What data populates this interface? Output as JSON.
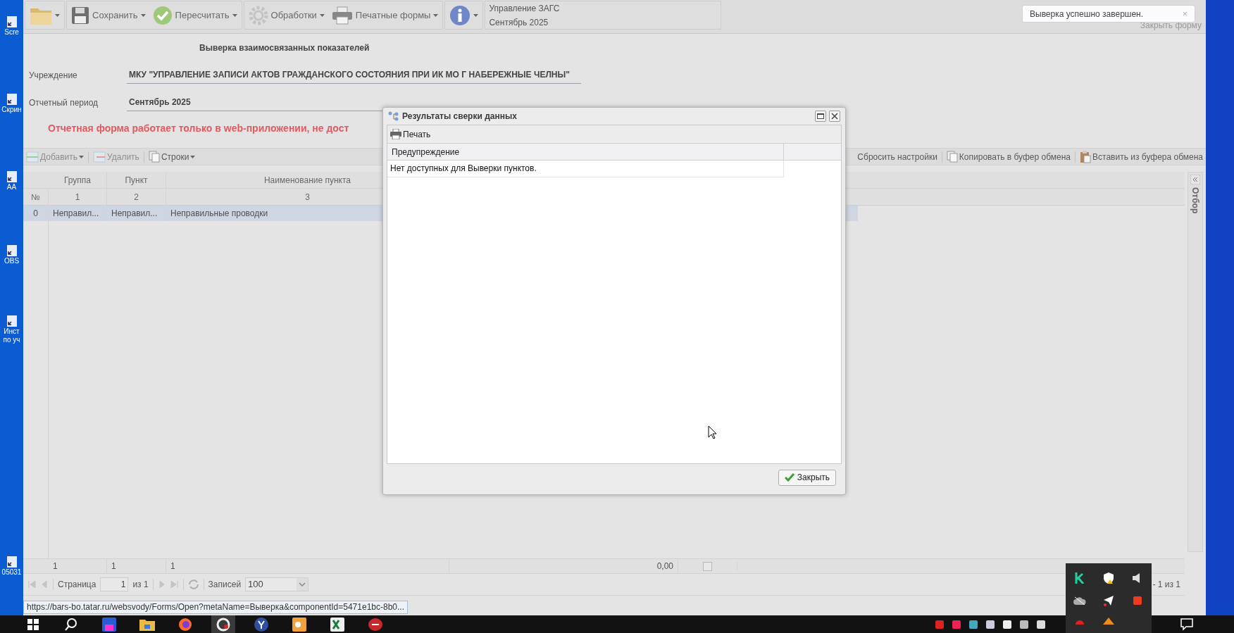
{
  "desktop_icons": [
    {
      "label": "Scre"
    },
    {
      "label": "Скрин"
    },
    {
      "label": "АА"
    },
    {
      "label": "OBS"
    },
    {
      "label": "Инст\nпо уч"
    },
    {
      "label": "05031"
    }
  ],
  "toolbar": {
    "groups": [
      {
        "items": [
          {
            "kind": "folder",
            "dropdown": true
          }
        ]
      },
      {
        "items": [
          {
            "kind": "save",
            "label": "Сохранить",
            "dropdown": true
          },
          {
            "kind": "check",
            "label": "Пересчитать",
            "dropdown": true
          }
        ]
      },
      {
        "items": [
          {
            "kind": "gear",
            "label": "Обработки",
            "dropdown": true
          },
          {
            "kind": "printer",
            "label": "Печатные формы",
            "dropdown": true
          }
        ]
      },
      {
        "items": [
          {
            "kind": "info",
            "dropdown": true
          }
        ]
      }
    ],
    "context": [
      "Управление ЗАГС",
      "Сентябрь 2025"
    ],
    "close_form": "Закрыть форму"
  },
  "notification": {
    "text": "Выверка успешно завершен.",
    "close": "×"
  },
  "form": {
    "title": "Выверка взаимосвязанных показателей",
    "fields": [
      {
        "label": "Учреждение",
        "value": "МКУ \"УПРАВЛЕНИЕ ЗАПИСИ АКТОВ ГРАЖДАНСКОГО СОСТОЯНИЯ ПРИ ИК МО Г НАБЕРЕЖНЫЕ ЧЕЛНЫ\""
      },
      {
        "label": "Отчетный период",
        "value": "Сентябрь 2025"
      }
    ],
    "warning": "Отчетная форма работает только в web-приложении, не дост"
  },
  "grid_toolbar": {
    "left": [
      {
        "kind": "add",
        "label": "Добавить",
        "disabled": true,
        "dropdown": true
      },
      {
        "kind": "remove",
        "label": "Удалить",
        "disabled": true,
        "dropdown": false
      },
      {
        "kind": "pages",
        "label": "Строки",
        "disabled": false,
        "dropdown": true
      }
    ],
    "right": [
      {
        "kind": "none",
        "label": "Сбросить настройки",
        "disabled": false,
        "dropdown": false
      },
      {
        "kind": "copy",
        "label": "Копировать в буфер обмена",
        "disabled": false,
        "dropdown": false
      },
      {
        "kind": "paste",
        "label": "Вставить из буфера обмена",
        "disabled": false,
        "dropdown": false
      }
    ]
  },
  "grid": {
    "header": [
      "Группа",
      "Пункт",
      "Наименование пункта"
    ],
    "numbers": [
      "№",
      "1",
      "2",
      "3"
    ],
    "rows": [
      {
        "cells": [
          "0",
          "Неправил...",
          "Неправил...",
          "Неправильные проводки"
        ],
        "selected": true
      }
    ],
    "summary": {
      "cells": [
        "",
        "1",
        "1",
        "1",
        "",
        "0,00"
      ],
      "checked": false
    }
  },
  "pager": {
    "page_label": "Страница",
    "page": "1",
    "page_of": "из 1",
    "records_label": "Записей",
    "records": "100",
    "info": "- 1 из 1"
  },
  "filter_panel": {
    "label": "Отбор"
  },
  "dialog": {
    "title": "Результаты сверки данных",
    "print": "Печать",
    "column": "Предупреждение",
    "rows": [
      "Нет доступных для Выверки пунктов."
    ],
    "close": "Закрыть"
  },
  "status_url": "https://bars-bo.tatar.ru/websvody/Forms/Open?metaName=Выверка&componentId=5471e1bc-8b0...",
  "taskbar": {
    "apps": [
      {
        "kind": "windows",
        "selected": false
      },
      {
        "kind": "search",
        "selected": false
      },
      {
        "kind": "floppy",
        "selected": false
      },
      {
        "kind": "folder",
        "selected": false
      },
      {
        "kind": "firefox",
        "selected": false
      },
      {
        "kind": "c",
        "selected": true
      },
      {
        "kind": "y",
        "selected": false
      },
      {
        "kind": "outlook",
        "selected": false
      },
      {
        "kind": "excel",
        "selected": false
      },
      {
        "kind": "red",
        "selected": false
      }
    ]
  }
}
